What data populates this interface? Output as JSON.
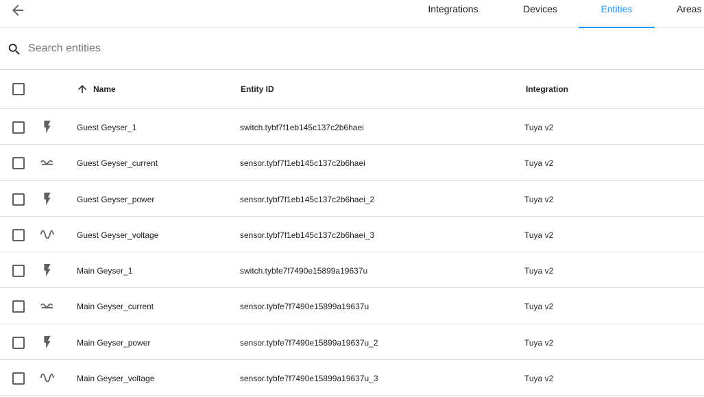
{
  "nav": {
    "tabs": [
      {
        "label": "Integrations"
      },
      {
        "label": "Devices"
      },
      {
        "label": "Entities"
      },
      {
        "label": "Areas"
      }
    ],
    "active_tab": "Entities",
    "accent_color": "#2196f3"
  },
  "search": {
    "placeholder": "Search entities",
    "value": ""
  },
  "table": {
    "headers": {
      "name": "Name",
      "entity_id": "Entity ID",
      "integration": "Integration"
    },
    "sort": {
      "column": "Name",
      "direction": "ascending",
      "icon": "arrow-up-icon"
    },
    "rows": [
      {
        "icon": "flash-icon",
        "name": "Guest Geyser_1",
        "entity_id": "switch.tybf7f1eb145c137c2b6haei",
        "integration": "Tuya v2"
      },
      {
        "icon": "current-icon",
        "name": "Guest Geyser_current",
        "entity_id": "sensor.tybf7f1eb145c137c2b6haei",
        "integration": "Tuya v2"
      },
      {
        "icon": "flash-icon",
        "name": "Guest Geyser_power",
        "entity_id": "sensor.tybf7f1eb145c137c2b6haei_2",
        "integration": "Tuya v2"
      },
      {
        "icon": "sine-wave-icon",
        "name": "Guest Geyser_voltage",
        "entity_id": "sensor.tybf7f1eb145c137c2b6haei_3",
        "integration": "Tuya v2"
      },
      {
        "icon": "flash-icon",
        "name": "Main Geyser_1",
        "entity_id": "switch.tybfe7f7490e15899a19637u",
        "integration": "Tuya v2"
      },
      {
        "icon": "current-icon",
        "name": "Main Geyser_current",
        "entity_id": "sensor.tybfe7f7490e15899a19637u",
        "integration": "Tuya v2"
      },
      {
        "icon": "flash-icon",
        "name": "Main Geyser_power",
        "entity_id": "sensor.tybfe7f7490e15899a19637u_2",
        "integration": "Tuya v2"
      },
      {
        "icon": "sine-wave-icon",
        "name": "Main Geyser_voltage",
        "entity_id": "sensor.tybfe7f7490e15899a19637u_3",
        "integration": "Tuya v2"
      }
    ]
  }
}
